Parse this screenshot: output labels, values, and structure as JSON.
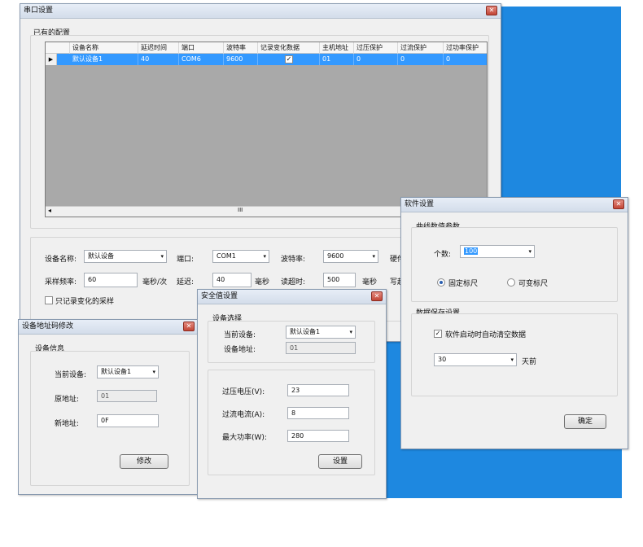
{
  "serial_window": {
    "title": "串口设置",
    "existing_group": "已有的配置",
    "columns": [
      "设备名称",
      "延迟时间",
      "端口",
      "波特率",
      "记录变化数据",
      "主机地址",
      "过压保护",
      "过流保护",
      "过功率保护"
    ],
    "row": {
      "name": "默认设备1",
      "delay": "40",
      "port": "COM6",
      "baud": "9600",
      "record": "✓",
      "host": "01",
      "ov": "0",
      "oc": "0",
      "op": "0"
    },
    "scroll_left": "◂",
    "scroll_mid": "III",
    "scroll_right": "▸",
    "device_name_label": "设备名称:",
    "device_name_value": "默认设备",
    "port_label": "端口:",
    "port_value": "COM1",
    "baud_label": "波特率:",
    "baud_value": "9600",
    "hw_label": "硬件",
    "sample_label": "采样频率:",
    "sample_value": "60",
    "sample_unit": "毫秒/次",
    "delay_label": "延迟:",
    "delay_value": "40",
    "delay_unit": "毫秒",
    "timeout_label": "读超时:",
    "timeout_value": "500",
    "timeout_unit": "毫秒",
    "write_label": "写超",
    "only_record_label": "只记录变化的采样"
  },
  "addr_window": {
    "title": "设备地址码修改",
    "group": "设备信息",
    "current_label": "当前设备:",
    "current_value": "默认设备1",
    "orig_label": "原地址:",
    "orig_value": "01",
    "new_label": "新地址:",
    "new_value": "0F",
    "modify_btn": "修改"
  },
  "safety_window": {
    "title": "安全值设置",
    "group": "设备选择",
    "current_label": "当前设备:",
    "current_value": "默认设备1",
    "addr_label": "设备地址:",
    "addr_value": "01",
    "ov_label": "过压电压(V):",
    "ov_value": "23",
    "oc_label": "过流电流(A):",
    "oc_value": "8",
    "op_label": "最大功率(W):",
    "op_value": "280",
    "set_btn": "设置"
  },
  "software_window": {
    "title": "软件设置",
    "curve_group": "曲线数值参数",
    "count_label": "个数:",
    "count_value": "100",
    "fixed_label": "固定标尺",
    "variable_label": "可变标尺",
    "save_group": "数据保存设置",
    "autoclear_label": "软件启动时自动清空数据",
    "days_value": "30",
    "days_unit": "天前",
    "ok_btn": "确定"
  },
  "icons": {
    "close": "✕",
    "dropdown": "▾",
    "check": "✓",
    "row_pointer": "▶"
  },
  "colors": {
    "desktop_blue": "#1e88e0",
    "selection": "#3399ff"
  }
}
